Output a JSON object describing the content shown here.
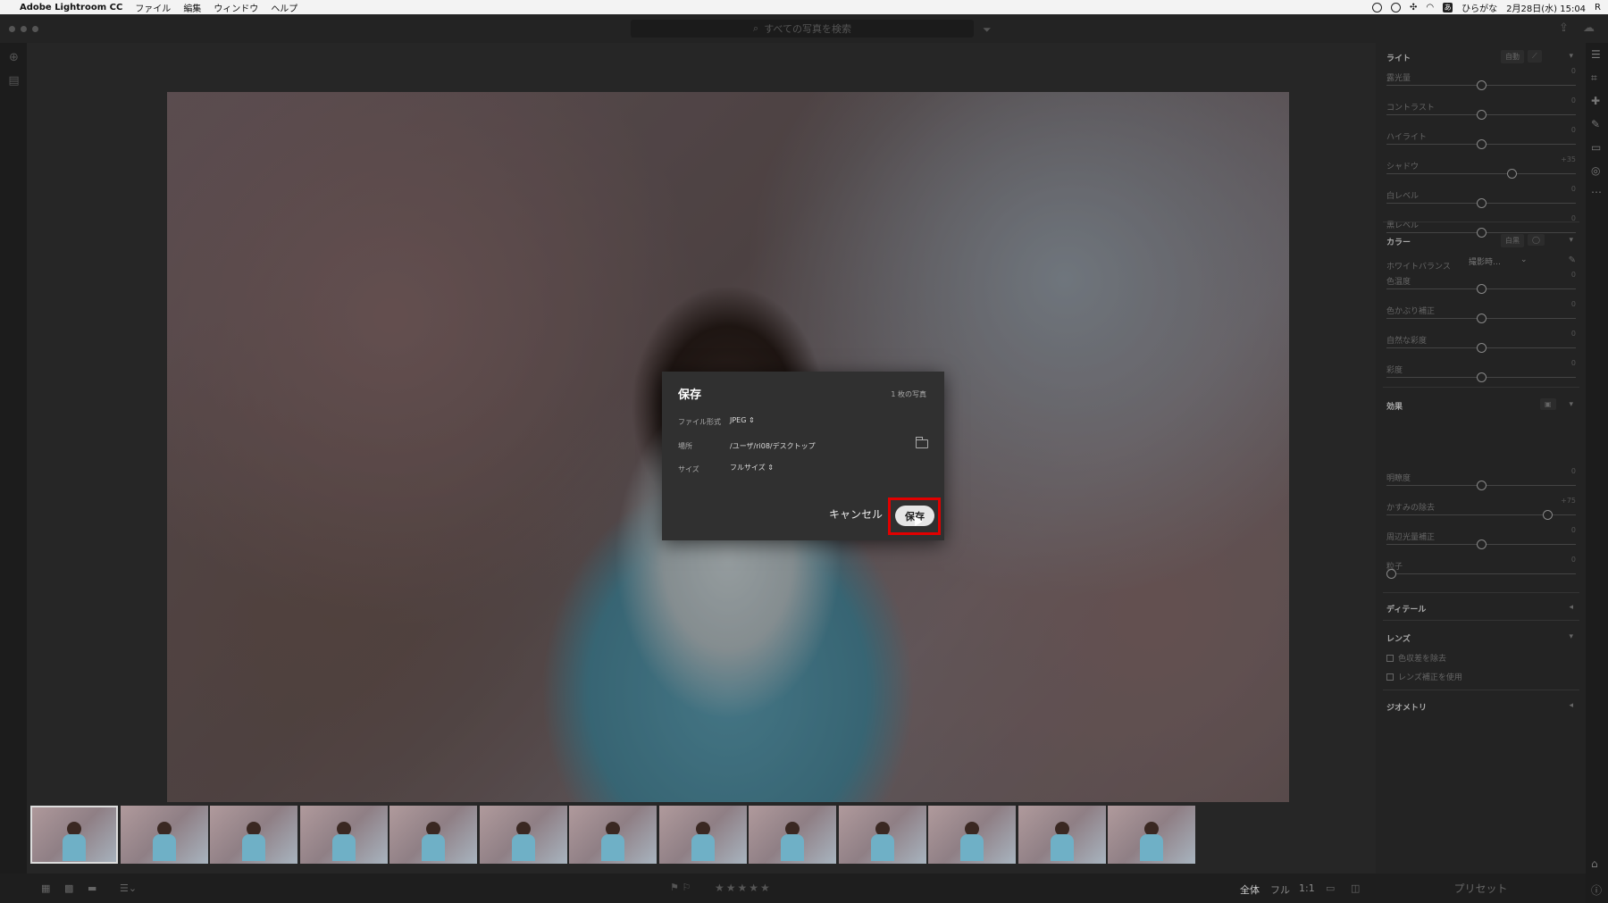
{
  "menubar": {
    "app_name": "Adobe Lightroom CC",
    "items": [
      "ファイル",
      "編集",
      "ウィンドウ",
      "ヘルプ"
    ],
    "input_method": "ひらがな",
    "datetime": "2月28日(水) 15:04",
    "trailing": "R"
  },
  "toolbar": {
    "search_placeholder": "すべての写真を検索"
  },
  "dialog": {
    "title": "保存",
    "count": "1 枚の写真",
    "format_label": "ファイル形式",
    "format_value": "JPEG ⇕",
    "location_label": "場所",
    "location_value": "/ユーザ/ri08/デスクトップ",
    "size_label": "サイズ",
    "size_value": "フルサイズ ⇕",
    "cancel_label": "キャンセル",
    "save_label": "保存"
  },
  "bottombar": {
    "zoom_all": "全体",
    "zoom_full": "フル",
    "zoom_11": "1:1",
    "stars": "★★★★★"
  },
  "panel": {
    "light": {
      "title": "ライト",
      "auto_label": "自動",
      "sliders": [
        {
          "name": "露光量",
          "value": "0",
          "pos": 0.5
        },
        {
          "name": "コントラスト",
          "value": "0",
          "pos": 0.5
        },
        {
          "name": "ハイライト",
          "value": "0",
          "pos": 0.5
        },
        {
          "name": "シャドウ",
          "value": "+35",
          "pos": 0.67
        },
        {
          "name": "白レベル",
          "value": "0",
          "pos": 0.5
        },
        {
          "name": "黒レベル",
          "value": "0",
          "pos": 0.5
        }
      ]
    },
    "color": {
      "title": "カラー",
      "bw_label": "白黒",
      "wb_label": "ホワイトバランス",
      "wb_value": "撮影時…",
      "sliders": [
        {
          "name": "色温度",
          "value": "0",
          "pos": 0.5
        },
        {
          "name": "色かぶり補正",
          "value": "0",
          "pos": 0.5
        },
        {
          "name": "自然な彩度",
          "value": "0",
          "pos": 0.5
        },
        {
          "name": "彩度",
          "value": "0",
          "pos": 0.5
        }
      ]
    },
    "effects": {
      "title": "効果",
      "sliders": [
        {
          "name": "明瞭度",
          "value": "0",
          "pos": 0.5
        },
        {
          "name": "かすみの除去",
          "value": "+75",
          "pos": 0.87
        },
        {
          "name": "周辺光量補正",
          "value": "0",
          "pos": 0.5
        },
        {
          "name": "粒子",
          "value": "0",
          "pos": 0.0
        }
      ]
    },
    "detail_title": "ディテール",
    "lens": {
      "title": "レンズ",
      "chk1": "色収差を除去",
      "chk2": "レンズ補正を使用"
    },
    "geometry_title": "ジオメトリ",
    "preset_label": "プリセット"
  },
  "filmstrip": {
    "count": 13,
    "selected": 0
  }
}
